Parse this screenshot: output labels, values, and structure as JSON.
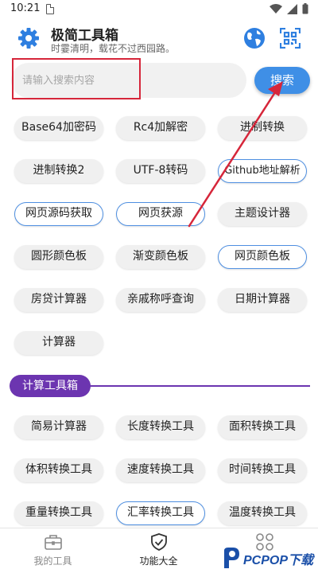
{
  "status_bar": {
    "time": "10:21"
  },
  "header": {
    "title": "极简工具箱",
    "subtitle": "时霎清明，载花不过西园路。",
    "icons": [
      "gear-icon",
      "globe-icon",
      "qr-scan-icon"
    ]
  },
  "search": {
    "placeholder": "请输入搜索内容",
    "value": "",
    "button_label": "搜索"
  },
  "tools": {
    "items": [
      {
        "label": "Base64加密码",
        "outlined": false
      },
      {
        "label": "Rc4加解密",
        "outlined": false
      },
      {
        "label": "进制转换",
        "outlined": false
      },
      {
        "label": "进制转换2",
        "outlined": false
      },
      {
        "label": "UTF-8转码",
        "outlined": false
      },
      {
        "label": "Github地址解析",
        "outlined": true
      },
      {
        "label": "网页源码获取",
        "outlined": true
      },
      {
        "label": "网页获源",
        "outlined": true
      },
      {
        "label": "主题设计器",
        "outlined": false
      },
      {
        "label": "圆形颜色板",
        "outlined": false
      },
      {
        "label": "渐变颜色板",
        "outlined": false
      },
      {
        "label": "网页颜色板",
        "outlined": true
      },
      {
        "label": "房贷计算器",
        "outlined": false
      },
      {
        "label": "亲戚称呼查询",
        "outlined": false
      },
      {
        "label": "日期计算器",
        "outlined": false
      },
      {
        "label": "计算器",
        "outlined": false
      }
    ]
  },
  "calc_section": {
    "title": "计算工具箱",
    "accent_color": "#6c35b0",
    "items": [
      {
        "label": "简易计算器",
        "outlined": false
      },
      {
        "label": "长度转换工具",
        "outlined": false
      },
      {
        "label": "面积转换工具",
        "outlined": false
      },
      {
        "label": "体积转换工具",
        "outlined": false
      },
      {
        "label": "速度转换工具",
        "outlined": false
      },
      {
        "label": "时间转换工具",
        "outlined": false
      },
      {
        "label": "重量转换工具",
        "outlined": false
      },
      {
        "label": "汇率转换工具",
        "outlined": true
      },
      {
        "label": "温度转换工具",
        "outlined": false
      }
    ]
  },
  "bottom_nav": {
    "items": [
      {
        "label": "我的工具",
        "icon": "briefcase-icon",
        "active": false
      },
      {
        "label": "功能大全",
        "icon": "shield-check-icon",
        "active": true
      },
      {
        "label": "",
        "icon": "grid-icon",
        "active": false
      }
    ]
  },
  "watermark": {
    "text": "PCPOP下载"
  },
  "colors": {
    "primary": "#3f8fe6",
    "highlight": "#d6263a",
    "section": "#6c35b0"
  }
}
